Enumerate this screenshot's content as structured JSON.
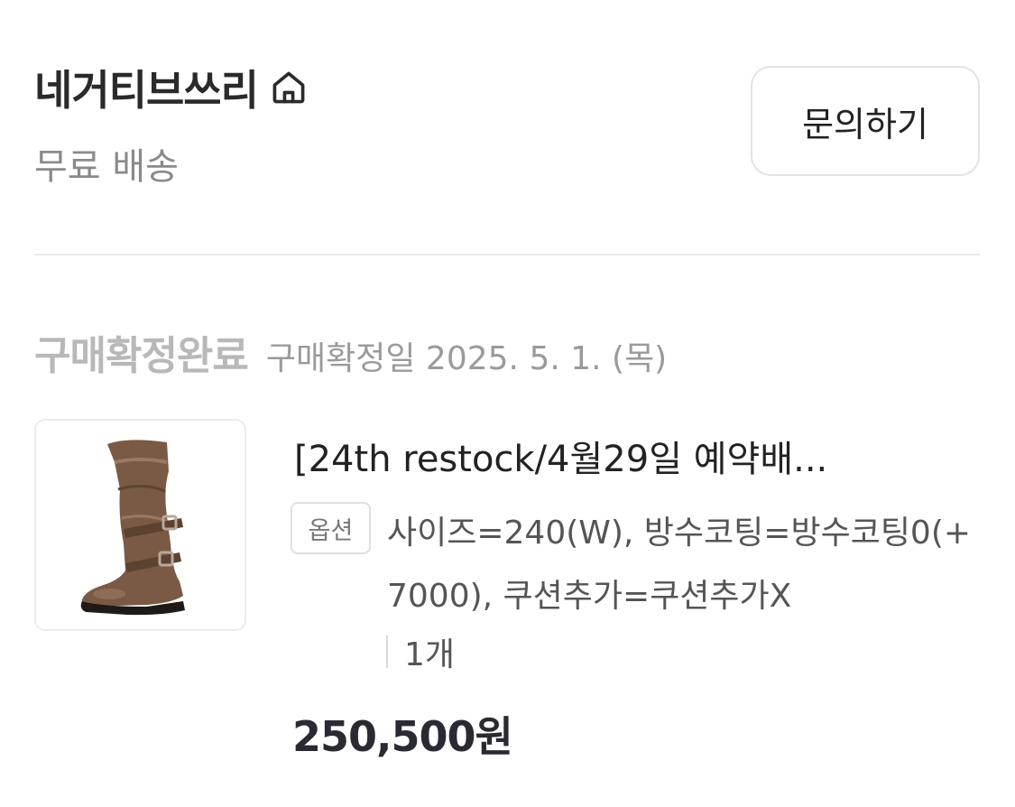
{
  "store": {
    "name": "네거티브쓰리",
    "home_icon": "home-icon",
    "shipping": "무료 배송",
    "inquiry_label": "문의하기"
  },
  "order": {
    "status": "구매확정완료",
    "confirm_date": "구매확정일 2025. 5. 1. (목)"
  },
  "product": {
    "title": "[24th restock/4월29일 예약배...",
    "option_badge": "옵션",
    "option_text": "사이즈=240(W), 방수코팅=방수코팅0(+7000), 쿠션추가=쿠션추가X",
    "quantity": "1개",
    "price": "250,500원",
    "image_icon": "boot-product-image"
  },
  "colors": {
    "status_gray": "#b8b8b8",
    "border": "#e3e3e3",
    "boot_brown": "#7a5a45"
  }
}
